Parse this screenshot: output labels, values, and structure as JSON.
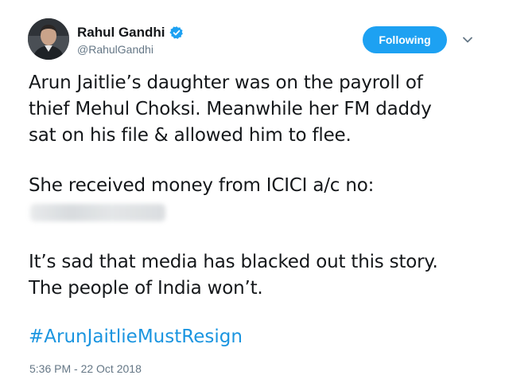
{
  "author": {
    "display_name": "Rahul Gandhi",
    "handle": "@RahulGandhi",
    "verified": true,
    "avatar": "profile-photo"
  },
  "follow_button": {
    "label": "Following",
    "color": "#1da1f2"
  },
  "menu_icon": "chevron-down-icon",
  "tweet": {
    "paragraph1": [
      "Arun Jaitlie’s daughter was on the payroll of",
      "thief Mehul Choksi. Meanwhile her FM daddy",
      "sat on his file & allowed him to flee."
    ],
    "paragraph2": "She received money from ICICI a/c no:",
    "paragraph3": [
      "It’s sad that media has blacked out this story.",
      "The people of India won’t."
    ],
    "hashtag": "#ArunJaitlieMustResign",
    "hashtag_color": "#1b95e0"
  },
  "timestamp": "5:36 PM - 22 Oct 2018"
}
